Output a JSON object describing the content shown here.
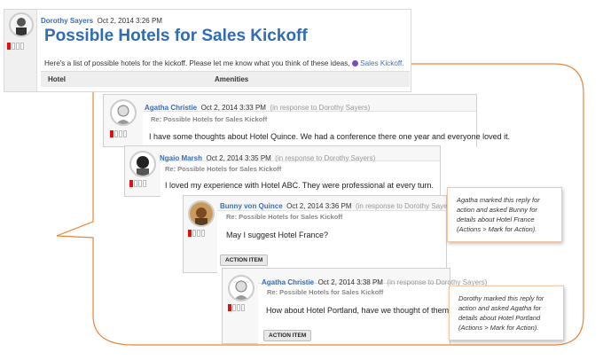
{
  "main_post": {
    "author": "Dorothy Sayers",
    "timestamp": "Oct 2, 2014 3:26 PM",
    "title": "Possible Hotels for Sales Kickoff",
    "body": "Here's a list of possible hotels for the kickoff. Please let me know what you think of these ideas,",
    "place_link": "Sales Kickoff.",
    "table_headers": [
      "Hotel",
      "Amenities"
    ]
  },
  "replies": [
    {
      "author": "Agatha Christie",
      "timestamp": "Oct 2, 2014 3:33 PM",
      "in_response": "(in response to Dorothy Sayers)",
      "subject": "Re: Possible Hotels for Sales Kickoff",
      "body": "I have some thoughts about Hotel Quince. We had a conference there one year and everyone loved it."
    },
    {
      "author": "Ngaio Marsh",
      "timestamp": "Oct 2, 2014 3:35 PM",
      "in_response": "(in response to Dorothy Sayers)",
      "subject": "Re: Possible Hotels for Sales Kickoff",
      "body": "I loved my experience with Hotel ABC. They were professional at every turn."
    },
    {
      "author": "Bunny von Quince",
      "timestamp": "Oct 2, 2014 3:36 PM",
      "in_response": "(in response to Dorothy Sayers)",
      "subject": "Re: Possible Hotels for Sales Kickoff",
      "body": "May I suggest Hotel France?",
      "tag": "ACTION ITEM"
    },
    {
      "author": "Agatha Christie",
      "timestamp": "Oct 2, 2014 3:38 PM",
      "in_response": "(in response to Dorothy Sayers)",
      "subject": "Re: Possible Hotels for Sales Kickoff",
      "body": "How about Hotel Portland, have we thought of them?",
      "tag": "ACTION ITEM"
    }
  ],
  "callouts": [
    {
      "text": "Agatha marked this reply for action and asked Bunny for details about Hotel France (Actions > Mark for Action)."
    },
    {
      "text": "Dorothy marked this reply for action and asked Agatha for details about Hotel Portland (Actions > Mark for Action)."
    }
  ],
  "colors": {
    "accent": "#3a6fb7",
    "callout_border": "#e8863a",
    "rating_on": "#d11111"
  },
  "icons": {
    "place": "place-icon"
  }
}
